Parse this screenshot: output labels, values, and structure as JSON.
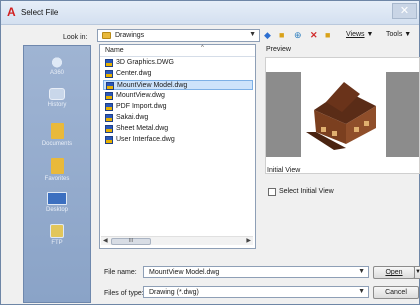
{
  "window": {
    "title": "Select File",
    "app_icon": "A",
    "close_glyph": "✕"
  },
  "toolbar": {
    "lookin_label": "Look in:",
    "lookin_value": "Drawings",
    "icons": [
      "back-icon",
      "up-folder-icon",
      "search-web-icon",
      "delete-icon",
      "new-folder-icon"
    ],
    "views_label": "Views",
    "tools_label": "Tools"
  },
  "places": [
    {
      "label": "A360",
      "icon": "a360-icon"
    },
    {
      "label": "History",
      "icon": "history-icon"
    },
    {
      "label": "Documents",
      "icon": "documents-icon"
    },
    {
      "label": "Favorites",
      "icon": "favorites-icon"
    },
    {
      "label": "Desktop",
      "icon": "desktop-icon"
    },
    {
      "label": "FTP",
      "icon": "ftp-icon"
    }
  ],
  "file_list": {
    "column_header": "Name",
    "files": [
      "3D Graphics.DWG",
      "Center.dwg",
      "MountView Model.dwg",
      "MountView.dwg",
      "PDF Import.dwg",
      "Sakai.dwg",
      "Sheet Metal.dwg",
      "User Interface.dwg"
    ],
    "selected_index": 2,
    "scroll_thumb_glyph": "III"
  },
  "preview": {
    "label": "Preview"
  },
  "initial_view": {
    "label": "Initial View",
    "checkbox_label": "Select Initial View",
    "checked": false
  },
  "fields": {
    "file_name_label": "File name:",
    "file_name_value": "MountView Model.dwg",
    "file_type_label": "Files of type:",
    "file_type_value": "Drawing (*.dwg)"
  },
  "buttons": {
    "open": "Open",
    "cancel": "Cancel"
  },
  "colors": {
    "brand_red": "#d11f1f",
    "selection": "#cde3fb",
    "places_bg": "#8aa3c7"
  }
}
